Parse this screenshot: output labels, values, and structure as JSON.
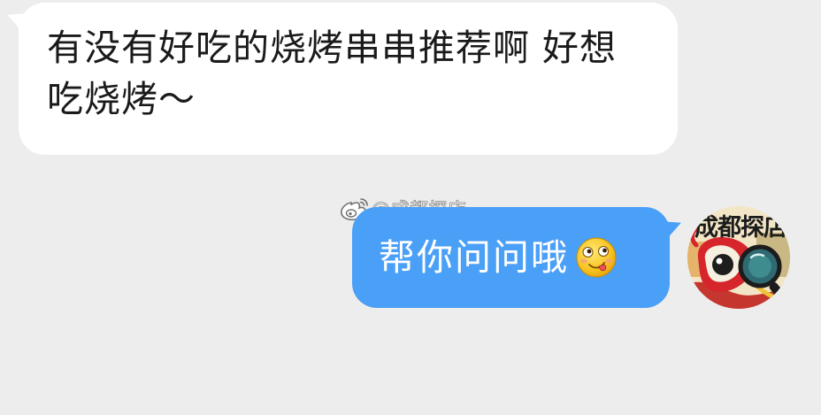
{
  "incoming_message": {
    "text": "有没有好吃的烧烤串串推荐啊 好想吃烧烤～"
  },
  "outgoing_message": {
    "sender_name": "@成都探店",
    "sender_platform_icon": "weibo-icon",
    "text": "帮你问问哦",
    "emoji": "drooling-face-emoji",
    "bubble_color": "#4a9ff7"
  },
  "avatar": {
    "caption_text": "成都探店",
    "icon": "weibo-eye-logo-avatar"
  },
  "colors": {
    "background": "#ededed",
    "incoming_bubble": "#ffffff",
    "outgoing_bubble": "#4a9ff7"
  }
}
